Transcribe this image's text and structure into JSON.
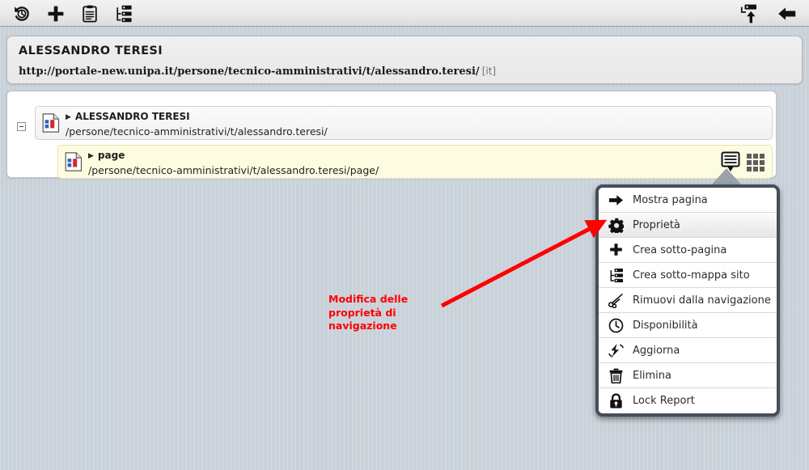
{
  "toolbar": {
    "left_buttons": [
      {
        "name": "history-icon",
        "label": "Cronologia"
      },
      {
        "name": "add-icon",
        "label": "Aggiungi"
      },
      {
        "name": "clipboard-icon",
        "label": "Appunti"
      },
      {
        "name": "sitemap-icon",
        "label": "Mappa sito"
      }
    ],
    "right_buttons": [
      {
        "name": "publish-upload-icon",
        "label": "Pubblica"
      },
      {
        "name": "back-arrow-icon",
        "label": "Indietro"
      }
    ]
  },
  "header": {
    "title": "ALESSANDRO TERESI",
    "url": "http://portale-new.unipa.it/persone/tecnico-amministrativi/t/alessandro.teresi/",
    "lang": "[it]"
  },
  "tree": {
    "collapse_toggle": "−",
    "items": [
      {
        "name": "ALESSANDRO TERESI",
        "path": "/persone/tecnico-amministrativi/t/alessandro.teresi/",
        "selected": false
      },
      {
        "name": "page",
        "path": "/persone/tecnico-amministrativi/t/alessandro.teresi/page/",
        "selected": true
      }
    ],
    "row_actions": [
      {
        "name": "row-menu-icon",
        "label": "Menu"
      },
      {
        "name": "grid-view-icon",
        "label": "Griglia"
      }
    ]
  },
  "context_menu": {
    "items": [
      {
        "icon": "arrow-right-icon",
        "label": "Mostra pagina",
        "hovered": false
      },
      {
        "icon": "gear-icon",
        "label": "Proprietà",
        "hovered": true
      },
      {
        "icon": "plus-icon",
        "label": "Crea sotto-pagina",
        "hovered": false
      },
      {
        "icon": "sitemap-icon",
        "label": "Crea sotto-mappa sito",
        "hovered": false
      },
      {
        "icon": "scissors-icon",
        "label": "Rimuovi dalla navigazione",
        "hovered": false
      },
      {
        "icon": "clock-icon",
        "label": "Disponibilità",
        "hovered": false
      },
      {
        "icon": "refresh-icon",
        "label": "Aggiorna",
        "hovered": false
      },
      {
        "icon": "trash-icon",
        "label": "Elimina",
        "hovered": false
      },
      {
        "icon": "lock-icon",
        "label": "Lock Report",
        "hovered": false
      }
    ]
  },
  "annotation": {
    "text": "Modifica delle proprietà di navigazione",
    "color": "#ff0000",
    "arrow_name": "annotation-arrow"
  },
  "colors": {
    "page_background": "#c9d1d9",
    "toolbar_background": "#ececec",
    "selected_row": "#fdfce0",
    "menu_border": "#454e59",
    "annotation": "#ff0000"
  }
}
